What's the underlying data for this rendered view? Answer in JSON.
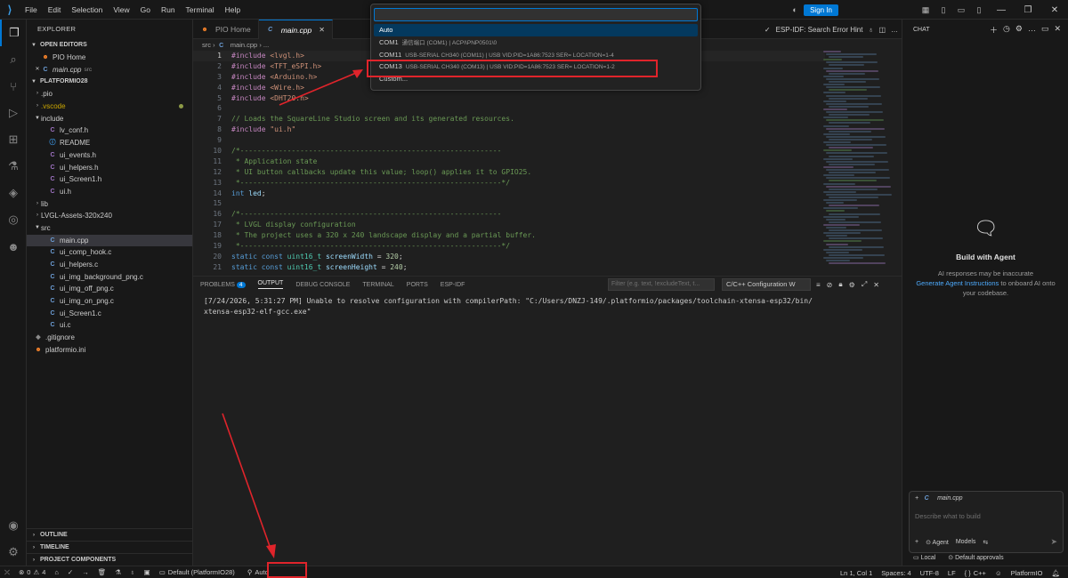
{
  "menu": [
    "File",
    "Edit",
    "Selection",
    "View",
    "Go",
    "Run",
    "Terminal",
    "Help"
  ],
  "titlebar": {
    "signin": "Sign In"
  },
  "explorer": {
    "title": "EXPLORER",
    "open_editors_label": "OPEN EDITORS",
    "open_editors": [
      {
        "name": "PIO Home",
        "hint": ""
      },
      {
        "name": "main.cpp",
        "hint": "src"
      }
    ],
    "project_label": "PLATFORMIO28",
    "tree": [
      {
        "name": ".pio",
        "kind": "folder",
        "depth": 1,
        "open": false
      },
      {
        "name": ".vscode",
        "kind": "folder",
        "depth": 1,
        "open": false,
        "color": "#cca700"
      },
      {
        "name": "include",
        "kind": "folder",
        "depth": 1,
        "open": true
      },
      {
        "name": "lv_conf.h",
        "kind": "h",
        "depth": 2
      },
      {
        "name": "README",
        "kind": "info",
        "depth": 2
      },
      {
        "name": "ui_events.h",
        "kind": "h",
        "depth": 2
      },
      {
        "name": "ui_helpers.h",
        "kind": "h",
        "depth": 2
      },
      {
        "name": "ui_Screen1.h",
        "kind": "h",
        "depth": 2
      },
      {
        "name": "ui.h",
        "kind": "h",
        "depth": 2
      },
      {
        "name": "lib",
        "kind": "folder",
        "depth": 1,
        "open": false
      },
      {
        "name": "LVGL-Assets-320x240",
        "kind": "folder",
        "depth": 1,
        "open": false
      },
      {
        "name": "src",
        "kind": "folder",
        "depth": 1,
        "open": true
      },
      {
        "name": "main.cpp",
        "kind": "c",
        "depth": 2,
        "selected": true
      },
      {
        "name": "ui_comp_hook.c",
        "kind": "c",
        "depth": 2
      },
      {
        "name": "ui_helpers.c",
        "kind": "c",
        "depth": 2
      },
      {
        "name": "ui_img_background_png.c",
        "kind": "c",
        "depth": 2
      },
      {
        "name": "ui_img_off_png.c",
        "kind": "c",
        "depth": 2
      },
      {
        "name": "ui_img_on_png.c",
        "kind": "c",
        "depth": 2
      },
      {
        "name": "ui_Screen1.c",
        "kind": "c",
        "depth": 2
      },
      {
        "name": "ui.c",
        "kind": "c",
        "depth": 2
      },
      {
        "name": ".gitignore",
        "kind": "git",
        "depth": 1
      },
      {
        "name": "platformio.ini",
        "kind": "pio",
        "depth": 1
      }
    ],
    "bottom_sections": [
      "OUTLINE",
      "TIMELINE",
      "PROJECT COMPONENTS"
    ]
  },
  "tabs": [
    {
      "label": "PIO Home",
      "active": false
    },
    {
      "label": "main.cpp",
      "active": true
    }
  ],
  "tabs_right": {
    "hint": "ESP-IDF: Search Error Hint"
  },
  "breadcrumb": {
    "folder": "src",
    "file": "main.cpp",
    "more": "..."
  },
  "code": [
    [
      [
        "k",
        "#include "
      ],
      [
        "s",
        "<lvgl.h>"
      ]
    ],
    [
      [
        "k",
        "#include "
      ],
      [
        "s",
        "<TFT_eSPI.h>"
      ]
    ],
    [
      [
        "k",
        "#include "
      ],
      [
        "s",
        "<Arduino.h>"
      ]
    ],
    [
      [
        "k",
        "#include "
      ],
      [
        "s",
        "<Wire.h>"
      ]
    ],
    [
      [
        "k",
        "#include "
      ],
      [
        "s",
        "<DHT20.h>"
      ]
    ],
    [],
    [
      [
        "cm",
        "// Loads the SquareLine Studio screen and its generated resources."
      ]
    ],
    [
      [
        "k",
        "#include "
      ],
      [
        "s",
        "\"ui.h\""
      ]
    ],
    [],
    [
      [
        "cm",
        "/*-------------------------------------------------------------"
      ]
    ],
    [
      [
        "cm",
        " * Application state"
      ]
    ],
    [
      [
        "cm",
        " * UI button callbacks update this value; loop() applies it to GPIO25."
      ]
    ],
    [
      [
        "cm",
        " *-------------------------------------------------------------*/"
      ]
    ],
    [
      [
        "t",
        "int "
      ],
      [
        "v",
        "led"
      ],
      [
        "p",
        ";"
      ]
    ],
    [],
    [
      [
        "cm",
        "/*-------------------------------------------------------------"
      ]
    ],
    [
      [
        "cm",
        " * LVGL display configuration"
      ]
    ],
    [
      [
        "cm",
        " * The project uses a 320 x 240 landscape display and a partial buffer."
      ]
    ],
    [
      [
        "cm",
        " *-------------------------------------------------------------*/"
      ]
    ],
    [
      [
        "t",
        "static const "
      ],
      [
        "ty",
        "uint16_t "
      ],
      [
        "v",
        "screenWidth"
      ],
      [
        "p",
        " = "
      ],
      [
        "n",
        "320"
      ],
      [
        "p",
        ";"
      ]
    ],
    [
      [
        "t",
        "static const "
      ],
      [
        "ty",
        "uint16_t "
      ],
      [
        "v",
        "screenHeight"
      ],
      [
        "p",
        " = "
      ],
      [
        "n",
        "240"
      ],
      [
        "p",
        ";"
      ]
    ]
  ],
  "panel": {
    "tabs": [
      {
        "label": "PROBLEMS",
        "badge": "4",
        "active": false
      },
      {
        "label": "OUTPUT",
        "active": true
      },
      {
        "label": "DEBUG CONSOLE",
        "active": false
      },
      {
        "label": "TERMINAL",
        "active": false
      },
      {
        "label": "PORTS",
        "active": false
      },
      {
        "label": "ESP-IDF",
        "active": false
      }
    ],
    "filter_placeholder": "Filter (e.g. text, !excludeText, t...",
    "channel": "C/C++ Configuration W",
    "output": "[7/24/2026, 5:31:27 PM] Unable to resolve configuration with compilerPath: \"C:/Users/DNZJ-149/.platformio/packages/toolchain-xtensa-esp32/bin/\nxtensa-esp32-elf-gcc.exe\""
  },
  "quickpick": {
    "input_value": "",
    "items": [
      {
        "label": "Auto",
        "desc": "",
        "selected": true
      },
      {
        "label": "COM1",
        "desc": "通信端口 (COM1) | ACPI\\PNP0501\\0",
        "selected": false
      },
      {
        "label": "COM11",
        "desc": "USB-SERIAL CH340 (COM11) | USB VID:PID=1A86:7523 SER= LOCATION=1-4",
        "selected": false
      },
      {
        "label": "COM13",
        "desc": "USB-SERIAL CH340 (COM13) | USB VID:PID=1A86:7523 SER= LOCATION=1-2",
        "selected": false
      },
      {
        "label": "Custom...",
        "desc": "",
        "selected": false
      }
    ]
  },
  "chat": {
    "title": "CHAT",
    "agent_title": "Build with Agent",
    "agent_desc_1": "AI responses may be inaccurate",
    "agent_link": "Generate Agent Instructions",
    "agent_desc_2": " to onboard AI onto your codebase.",
    "context_file": "main.cpp",
    "placeholder": "Describe what to build",
    "mode": "Agent",
    "models": "Models",
    "local": "Local",
    "approvals": "Default approvals"
  },
  "status": {
    "errors": "0",
    "warnings": "4",
    "env": "Default (PlatformIO28)",
    "port": "Auto",
    "position": "Ln 1, Col 1",
    "spaces": "Spaces: 4",
    "encoding": "UTF-8",
    "eol": "LF",
    "language": "C++",
    "platform": "PlatformIO"
  },
  "colors": {
    "accent": "#0078d4",
    "highlight": "#e0242b"
  }
}
